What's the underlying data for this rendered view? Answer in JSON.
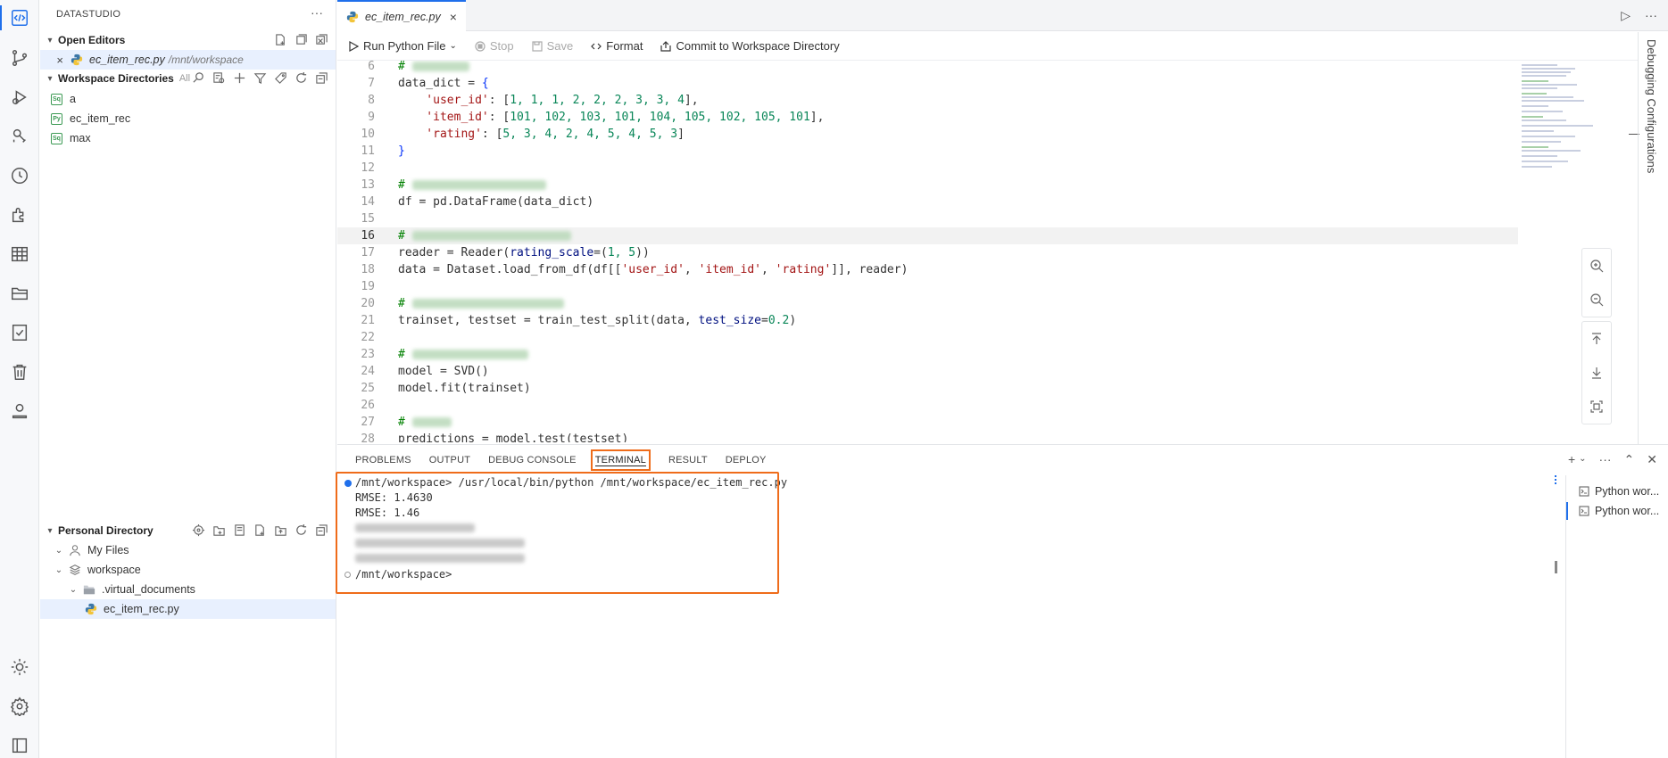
{
  "sidebar": {
    "title": "DATASTUDIO",
    "open_editors": {
      "label": "Open Editors",
      "file": "ec_item_rec.py",
      "path": "/mnt/workspace"
    },
    "workspace_dirs": {
      "label": "Workspace Directories",
      "all": "All",
      "items": [
        {
          "label": "a",
          "badge": "Sq"
        },
        {
          "label": "ec_item_rec",
          "badge": "Py"
        },
        {
          "label": "max",
          "badge": "Sq"
        }
      ]
    },
    "personal_dir": {
      "label": "Personal Directory",
      "items": [
        "My Files",
        "workspace",
        ".virtual_documents",
        "ec_item_rec.py"
      ]
    }
  },
  "editor": {
    "tab": "ec_item_rec.py",
    "toolbar": {
      "run": "Run Python File",
      "stop": "Stop",
      "save": "Save",
      "format": "Format",
      "commit": "Commit to Workspace Directory"
    },
    "line_numbers": [
      "6",
      "7",
      "8",
      "9",
      "10",
      "11",
      "12",
      "13",
      "14",
      "15",
      "16",
      "17",
      "18",
      "19",
      "20",
      "21",
      "22",
      "23",
      "24",
      "25",
      "26",
      "27",
      "28"
    ],
    "current_line": "16",
    "code": {
      "l6": "#",
      "l7a": "data_dict = ",
      "l7b": "{",
      "l8a": "    'user_id'",
      "l8b": ": [",
      "l8c": "1, 1, 1, 2, 2, 2, 3, 3, 4",
      "l8d": "],",
      "l9a": "    'item_id'",
      "l9b": ": [",
      "l9c": "101, 102, 103, 101, 104, 105, 102, 105, 101",
      "l9d": "],",
      "l10a": "    'rating'",
      "l10b": ": [",
      "l10c": "5, 3, 4, 2, 4, 5, 4, 5, 3",
      "l10d": "]",
      "l11": "}",
      "l13": "#",
      "l14": "df = pd.DataFrame(data_dict)",
      "l16": "#",
      "l17a": "reader = Reader(",
      "l17b": "rating_scale",
      "l17c": "=(",
      "l17d": "1, 5",
      "l17e": "))",
      "l18a": "data = Dataset.load_from_df(df[[",
      "l18b": "'user_id'",
      "l18c": ", ",
      "l18d": "'item_id'",
      "l18e": ", ",
      "l18f": "'rating'",
      "l18g": "]], reader)",
      "l20": "#",
      "l21a": "trainset, testset = train_test_split(data, ",
      "l21b": "test_size",
      "l21c": "=",
      "l21d": "0.2",
      "l21e": ")",
      "l23": "#",
      "l24": "model = SVD()",
      "l25": "model.fit(trainset)",
      "l27": "#",
      "l28": "predictions = model.test(testset)"
    },
    "right_strip": "Debugging Configurations"
  },
  "panel": {
    "tabs": [
      "PROBLEMS",
      "OUTPUT",
      "DEBUG CONSOLE",
      "TERMINAL",
      "RESULT",
      "DEPLOY"
    ],
    "active_tab": "TERMINAL",
    "terminal": {
      "cmd": "/mnt/workspace> /usr/local/bin/python /mnt/workspace/ec_item_rec.py",
      "out1": "RMSE: 1.4630",
      "out2": "RMSE: 1.46",
      "prompt": "/mnt/workspace>"
    },
    "terminals": [
      "Python wor...",
      "Python wor..."
    ]
  }
}
